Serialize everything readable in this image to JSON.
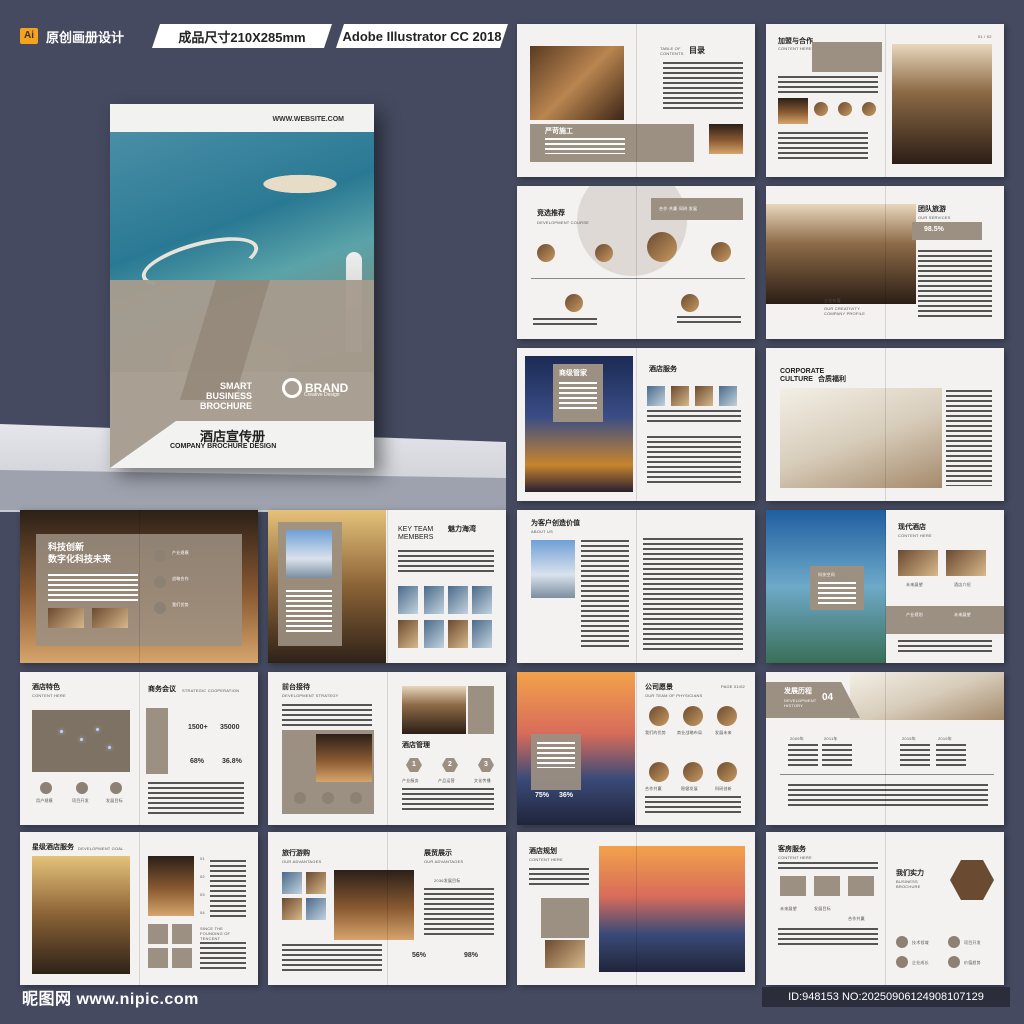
{
  "header": {
    "tag1": "原创画册设计",
    "tag1_icon": "Ai",
    "tag2": "成品尺寸210X285mm",
    "tag3": "Adobe Illustrator CC 2018"
  },
  "cover": {
    "url": "WWW.WEBSITE.COM",
    "smart": "SMART BUSINESS BROCHURE",
    "brand": "BRAND",
    "brand_sub": "Creative Design",
    "cn_title": "酒店宣传册",
    "en_title": "COMPANY BROCHURE DESIGN"
  },
  "spreads": {
    "s1": {
      "toc_en": "TABLE OF CONTENTS",
      "toc_cn": "目录",
      "label": "严苛施工"
    },
    "s2": {
      "title": "加盟与合作",
      "sub": "CONTENT HERE",
      "page": "01 / 02"
    },
    "s3": {
      "title": "竞选推荐",
      "sub": "DEVELOPMENT COURSE",
      "label": "合作·共赢·同树·发展"
    },
    "s4": {
      "title": "团队旅游",
      "sub": "OUR SERVICES",
      "pct": "98.5%",
      "note": "企业价值",
      "note2": "OUR CREATIVITY COMPANY PROFILE"
    },
    "s5": {
      "title": "商级管家",
      "title2": "酒店服务"
    },
    "s6": {
      "title": "CORPORATE CULTURE",
      "title_cn": "合质福利"
    },
    "s7": {
      "title1": "科技创新",
      "title2": "数字化科技未来",
      "item1": "产业规模",
      "item2": "战略合作",
      "item3": "我们优势"
    },
    "s8": {
      "title": "KEY TEAM MEMBERS",
      "title_cn": "魅力海湾"
    },
    "s9": {
      "title": "为客户创造价值",
      "sub": "ABOUT US"
    },
    "s10": {
      "title": "现代酒店",
      "sub": "CONTENT HERE",
      "label": "科技空间",
      "item1": "未来展望",
      "item2": "酒店介绍",
      "item3": "产业规划",
      "item4": "未来展望"
    },
    "s11": {
      "title": "酒店特色",
      "sub": "CONTENT HERE",
      "title2": "商务会议",
      "sub2": "STRATEGIC COOPERATION",
      "v1": "1500+",
      "v2": "35000",
      "v3": "68%",
      "v4": "36.8%",
      "l1": "用户规模",
      "l2": "项目开发",
      "l3": "发展目标"
    },
    "s12": {
      "title": "前台接待",
      "sub": "DEVELOPMENT STRATEGY",
      "title2": "酒店管理",
      "n1": "1",
      "n2": "2",
      "n3": "3",
      "l1": "产业服务",
      "l2": "产品运营",
      "l3": "文化传播"
    },
    "s13": {
      "title": "公司愿景",
      "sub": "OUR TEAM OF PHYSICIANS",
      "page": "PAGE 01/02",
      "p1": "75%",
      "p2": "36%",
      "r1": "我们的优势",
      "r2": "商业战略布局",
      "r3": "发展未来",
      "r4": "合作共赢",
      "r5": "稳健发展",
      "r6": "科研创新"
    },
    "s14": {
      "title": "发展历程",
      "sub": "DEVELOPMENT HISTORY",
      "num": "04",
      "y1": "2009年",
      "y2": "2011年",
      "y3": "2015年",
      "y4": "2019年"
    },
    "s15": {
      "title": "星级酒店服务",
      "sub": "DEVELOPMENT GOAL",
      "n1": "01",
      "n2": "02",
      "n3": "03",
      "n4": "04",
      "since": "SINCE THE FOUNDING OF TENCENT"
    },
    "s16": {
      "title": "旅行游购",
      "sub": "OUR ADVANTAGES",
      "title2": "展贸展示",
      "sub2": "OUR ADVANTAGES",
      "t1": "2036发展目标",
      "p1": "56%",
      "p2": "98%"
    },
    "s17": {
      "title": "酒店规划",
      "sub": "CONTENT HERE"
    },
    "s18": {
      "title": "客房服务",
      "sub": "CONTENT HERE",
      "title2": "我们实力",
      "sub2": "BUSINESS BROCHURE",
      "l1": "未来展望",
      "l2": "发展目标",
      "l3": "合作共赢",
      "l4": "技术领域",
      "l5": "项目开发",
      "l6": "企业成长",
      "l7": "价值趋势"
    }
  },
  "footer": {
    "left": "昵图网 www.nipic.com",
    "right": "ID:948153 NO:20250906124908107129"
  }
}
